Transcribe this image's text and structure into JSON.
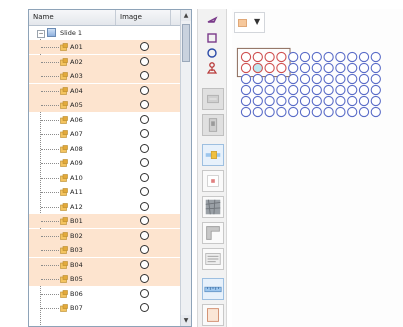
{
  "tree": {
    "headers": {
      "name": "Name",
      "image": "Image"
    },
    "slide": {
      "label": "Slide 1",
      "expander": "−"
    },
    "scroll": {
      "up": "▲",
      "down": "▼"
    },
    "wells": [
      {
        "label": "A01",
        "selected": true
      },
      {
        "label": "A02",
        "selected": true
      },
      {
        "label": "A03",
        "selected": true
      },
      {
        "label": "A04",
        "selected": true
      },
      {
        "label": "A05",
        "selected": true
      },
      {
        "label": "A06",
        "selected": false
      },
      {
        "label": "A07",
        "selected": false
      },
      {
        "label": "A08",
        "selected": false
      },
      {
        "label": "A09",
        "selected": false
      },
      {
        "label": "A10",
        "selected": false
      },
      {
        "label": "A11",
        "selected": false
      },
      {
        "label": "A12",
        "selected": false
      },
      {
        "label": "B01",
        "selected": true
      },
      {
        "label": "B02",
        "selected": true
      },
      {
        "label": "B03",
        "selected": true
      },
      {
        "label": "B04",
        "selected": true
      },
      {
        "label": "B05",
        "selected": true
      },
      {
        "label": "B06",
        "selected": false
      },
      {
        "label": "B07",
        "selected": false
      }
    ]
  },
  "toolbar": {
    "tools": [
      {
        "name": "pointer-tool",
        "icon": "arrow-icon"
      },
      {
        "name": "rectangle-tool",
        "icon": "square-icon"
      },
      {
        "name": "circle-tool",
        "icon": "circle-icon"
      },
      {
        "name": "pin-tool",
        "icon": "pin-icon"
      },
      {
        "name": "tool-gray-1",
        "icon": "dimmed-icon"
      },
      {
        "name": "tool-gray-2",
        "icon": "dimmed-icon"
      },
      {
        "name": "tool-active",
        "icon": "blue-marker-icon"
      },
      {
        "name": "tool-red-mark",
        "icon": "red-mark-icon"
      },
      {
        "name": "tool-texture",
        "icon": "texture-icon"
      },
      {
        "name": "tool-corner",
        "icon": "corner-icon"
      },
      {
        "name": "tool-text",
        "icon": "text-icon"
      },
      {
        "name": "tool-ruler",
        "icon": "ruler-icon"
      },
      {
        "name": "tool-frame",
        "icon": "frame-icon"
      }
    ]
  },
  "canvas": {
    "well_color": "#5a6cc8",
    "highlight_color": "#cf5050",
    "selected_fill": "#bfe8ef",
    "selection_box_color": "#8a6a5a",
    "accent_swatch": "#f6c89c",
    "plate": {
      "columns": 12,
      "rows": 6,
      "highlight_rows": 2,
      "highlight_cols": 4,
      "selected_well": {
        "row": 1,
        "col": 1
      }
    }
  }
}
